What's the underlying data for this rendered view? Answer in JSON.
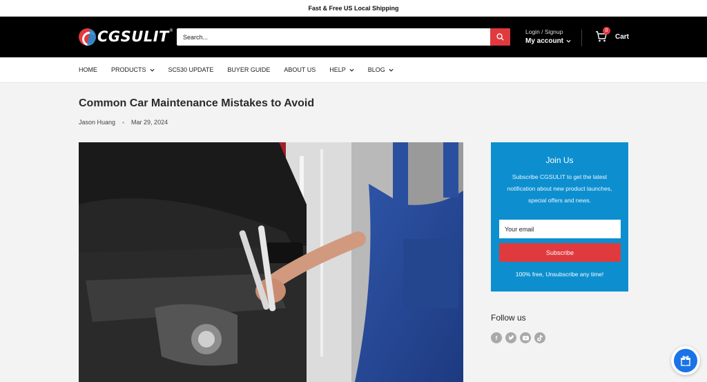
{
  "announcement": "Fast & Free US Local Shipping",
  "header": {
    "logo_text": "CGSULIT",
    "search_placeholder": "Search...",
    "account_small": "Login / Signup",
    "account_big": "My account",
    "cart_count": "0",
    "cart_label": "Cart"
  },
  "nav": {
    "items": [
      {
        "label": "HOME"
      },
      {
        "label": "PRODUCTS"
      },
      {
        "label": "SC530 UPDATE"
      },
      {
        "label": "BUYER GUIDE"
      },
      {
        "label": "ABOUT US"
      },
      {
        "label": "HELP"
      },
      {
        "label": "BLOG"
      }
    ]
  },
  "article": {
    "title": "Common Car Maintenance Mistakes to Avoid",
    "author": "Jason Huang",
    "date": "Mar 29, 2024"
  },
  "sidebar": {
    "join_title": "Join Us",
    "join_text": "Subscribe CGSULIT to get the latest notification about new product launches, special offers and news.",
    "email_placeholder": "Your email",
    "subscribe_label": "Subscribe",
    "free_text": "100% free, Unsubscribe any time!",
    "follow_title": "Follow us",
    "socials": [
      "facebook-icon",
      "twitter-icon",
      "youtube-icon",
      "tiktok-icon"
    ]
  },
  "colors": {
    "accent_red": "#e03a3e",
    "panel_blue": "#0d8fcf",
    "header_black": "#000000"
  }
}
